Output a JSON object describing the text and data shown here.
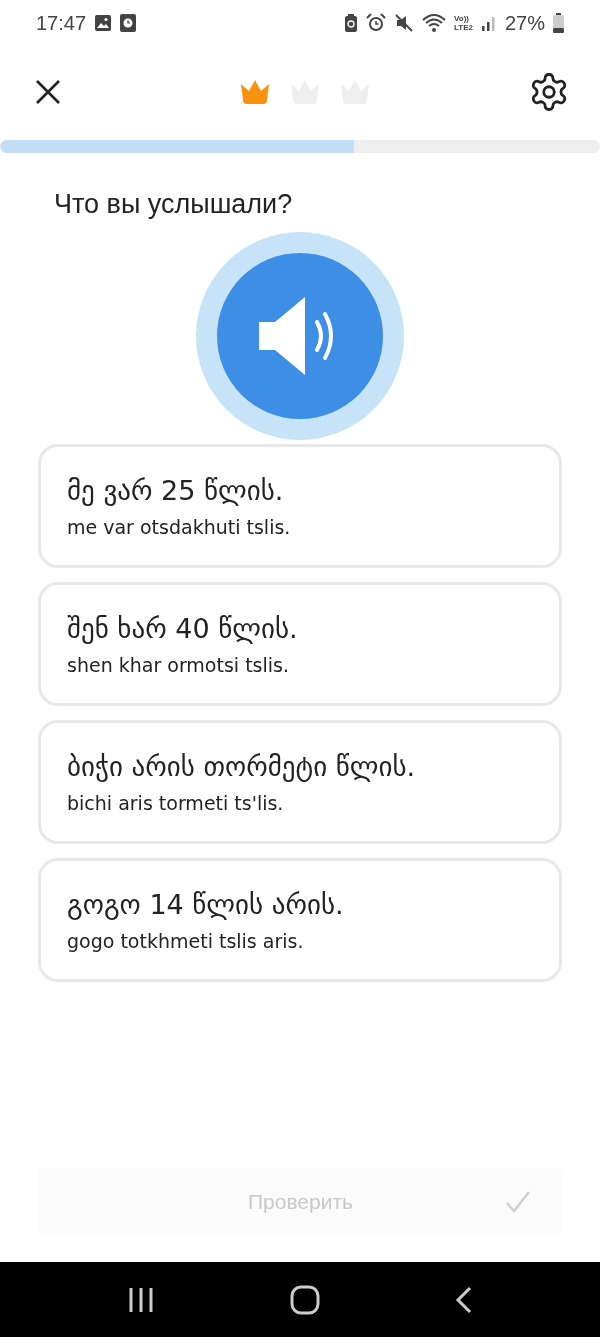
{
  "status_bar": {
    "time": "17:47",
    "volte": "Vo))",
    "network": "LTE2",
    "battery": "27%"
  },
  "header": {
    "crowns": [
      {
        "earned": true
      },
      {
        "earned": false
      },
      {
        "earned": false
      }
    ]
  },
  "progress": {
    "level": 0.59
  },
  "question": "Что вы услышали?",
  "options": [
    {
      "text": "მე ვარ 25 წლის.",
      "transliteration": "me var otsdakhuti tslis.",
      "selected": false
    },
    {
      "text": "შენ ხარ 40 წლის.",
      "transliteration": "shen khar ormotsi tslis.",
      "selected": false
    },
    {
      "text": "ბიჭი არის თორმეტი წლის.",
      "transliteration": "bichi aris tormeti ts'lis.",
      "selected": false
    },
    {
      "text": "გოგო 14 წლის არის.",
      "transliteration": "gogo totkhmeti tslis aris.",
      "selected": false
    }
  ],
  "check_button": {
    "label": "Проверить",
    "disabled": true
  }
}
